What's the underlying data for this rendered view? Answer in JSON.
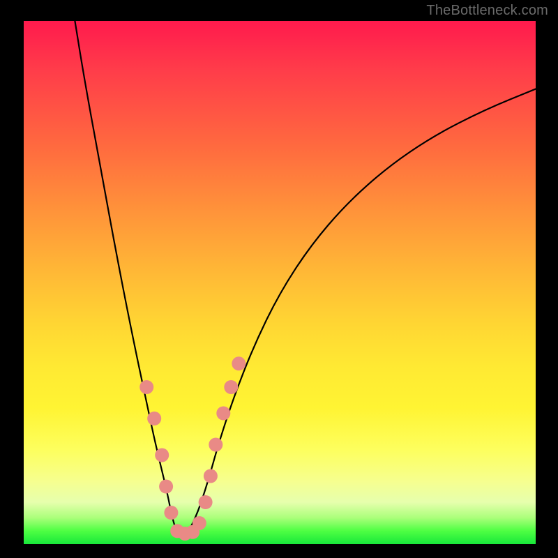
{
  "watermark": "TheBottleneck.com",
  "chart_data": {
    "type": "line",
    "title": "",
    "xlabel": "",
    "ylabel": "",
    "xlim": [
      0,
      100
    ],
    "ylim": [
      0,
      100
    ],
    "grid": false,
    "legend": false,
    "series": [
      {
        "name": "bottleneck-curve",
        "color": "#000000",
        "x": [
          10,
          12,
          15,
          18,
          21,
          24,
          26,
          28,
          29,
          30,
          31,
          32,
          34,
          36,
          38,
          41,
          45,
          50,
          56,
          63,
          71,
          80,
          90,
          100
        ],
        "y": [
          100,
          88,
          72,
          56,
          41,
          27,
          18,
          10,
          5,
          2,
          1,
          2,
          6,
          12,
          19,
          28,
          38,
          48,
          57,
          65,
          72,
          78,
          83,
          87
        ]
      }
    ],
    "markers": [
      {
        "name": "highlight-dots",
        "color": "#e98a86",
        "radius_px": 10,
        "points": [
          {
            "x": 24.0,
            "y": 30.0
          },
          {
            "x": 25.5,
            "y": 24.0
          },
          {
            "x": 27.0,
            "y": 17.0
          },
          {
            "x": 27.8,
            "y": 11.0
          },
          {
            "x": 28.8,
            "y": 6.0
          },
          {
            "x": 30.0,
            "y": 2.5
          },
          {
            "x": 31.5,
            "y": 2.0
          },
          {
            "x": 33.0,
            "y": 2.3
          },
          {
            "x": 34.3,
            "y": 4.0
          },
          {
            "x": 35.5,
            "y": 8.0
          },
          {
            "x": 36.5,
            "y": 13.0
          },
          {
            "x": 37.5,
            "y": 19.0
          },
          {
            "x": 39.0,
            "y": 25.0
          },
          {
            "x": 40.5,
            "y": 30.0
          },
          {
            "x": 42.0,
            "y": 34.5
          }
        ]
      }
    ],
    "gradient_stops": [
      {
        "pos": 0.0,
        "color": "#ff1a4d"
      },
      {
        "pos": 0.24,
        "color": "#ff6a3f"
      },
      {
        "pos": 0.48,
        "color": "#ffb836"
      },
      {
        "pos": 0.74,
        "color": "#fff433"
      },
      {
        "pos": 0.92,
        "color": "#e6ffad"
      },
      {
        "pos": 1.0,
        "color": "#18e83a"
      }
    ]
  }
}
